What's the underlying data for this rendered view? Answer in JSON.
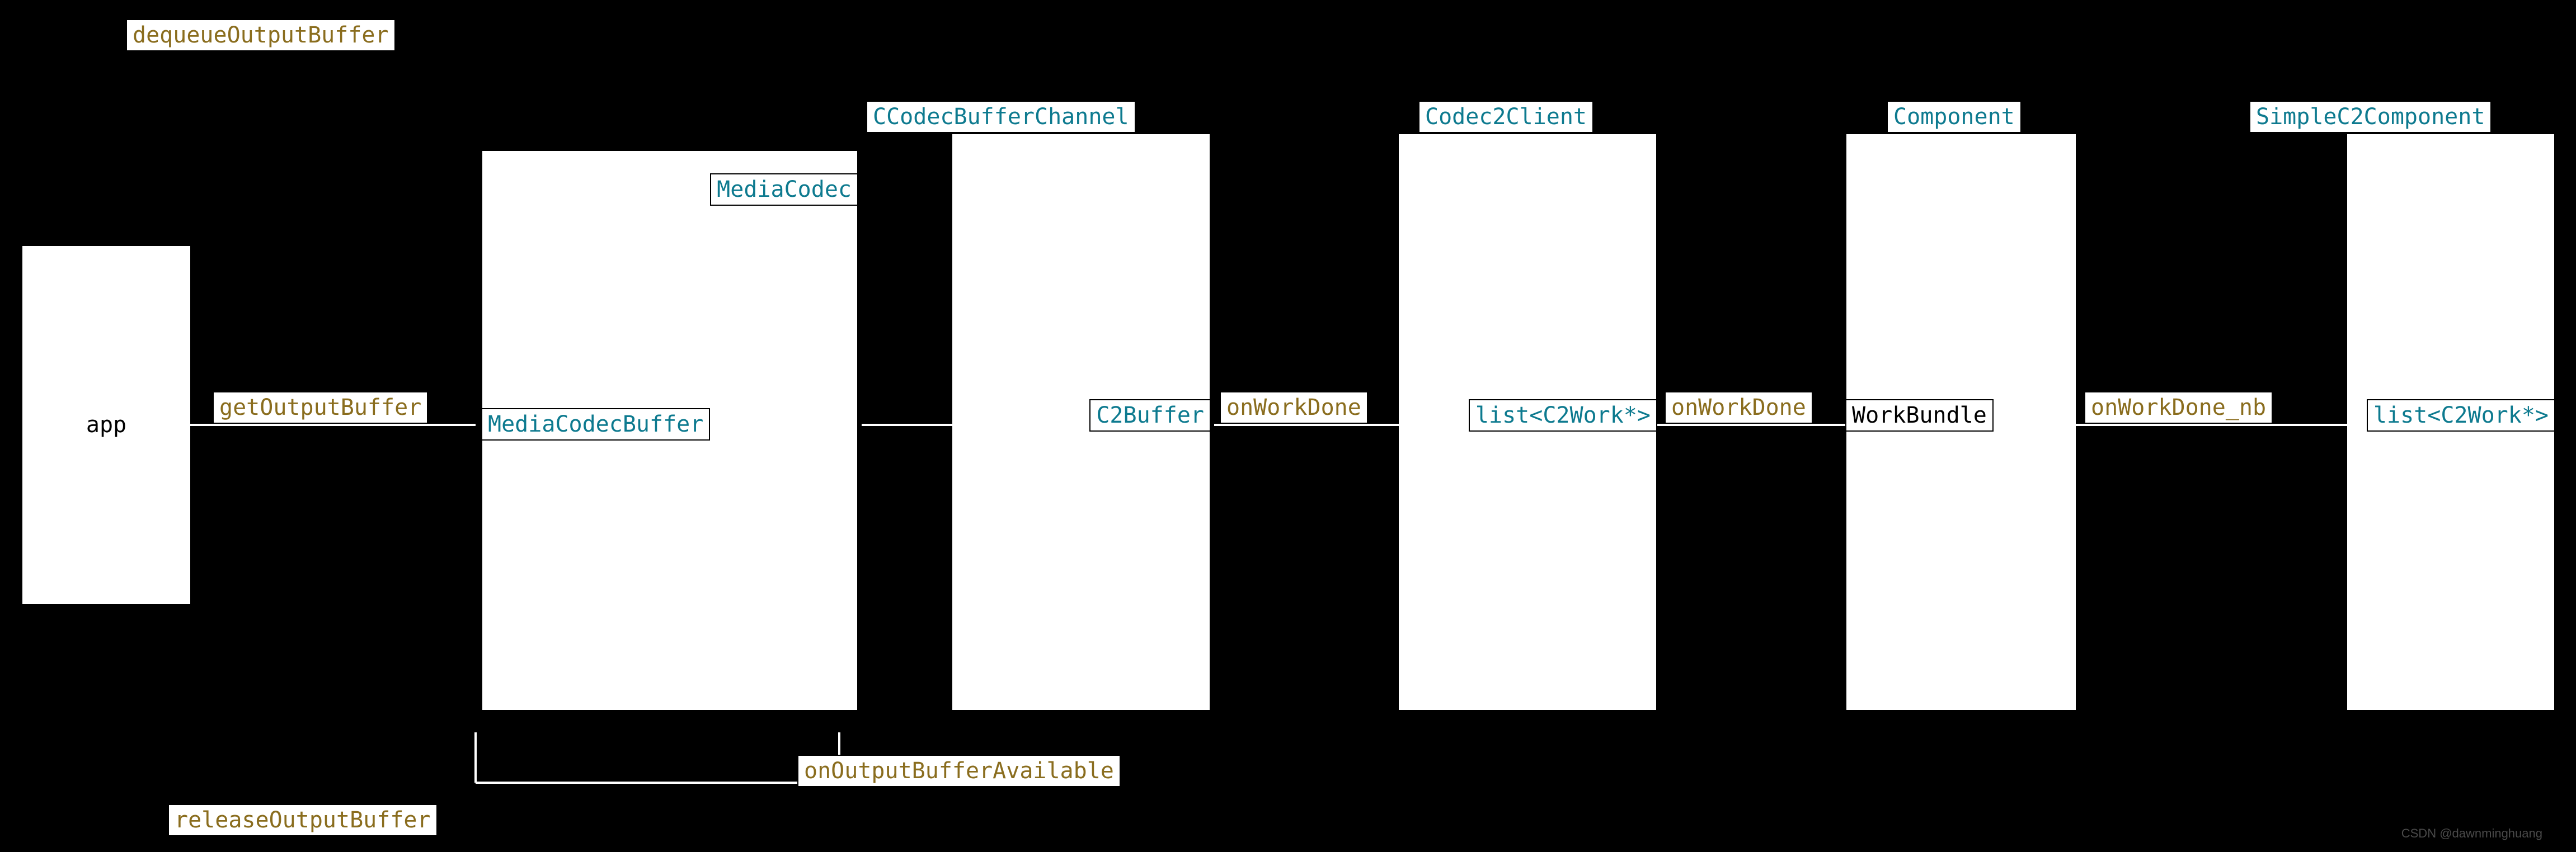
{
  "labels": {
    "dequeueOutputBuffer": "dequeueOutputBuffer",
    "getOutputBuffer": "getOutputBuffer",
    "releaseOutputBuffer": "releaseOutputBuffer",
    "onOutputBufferAvailable": "onOutputBufferAvailable",
    "onWorkDone1": "onWorkDone",
    "onWorkDone2": "onWorkDone",
    "onWorkDone_nb": "onWorkDone_nb"
  },
  "boxes": {
    "app": "app",
    "MediaCodec": "MediaCodec",
    "MediaCodecBuffer": "MediaCodecBuffer",
    "CCodecBufferChannel": "CCodecBufferChannel",
    "C2Buffer": "C2Buffer",
    "Codec2Client": "Codec2Client",
    "listC2Work1": "list<C2Work*>",
    "Component": "Component",
    "WorkBundle": "WorkBundle",
    "SimpleC2Component": "SimpleC2Component",
    "listC2Work2": "list<C2Work*>"
  },
  "watermark": "CSDN @dawnminghuang"
}
